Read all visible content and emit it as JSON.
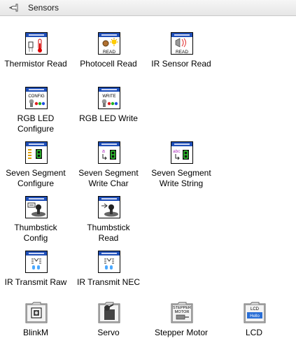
{
  "window": {
    "title": "Sensors"
  },
  "palette": [
    {
      "id": "thermistor-read",
      "label": "Thermistor Read",
      "icon": "thermistor-read-icon"
    },
    {
      "id": "photocell-read",
      "label": "Photocell Read",
      "icon": "photocell-read-icon",
      "icon_text": "READ"
    },
    {
      "id": "ir-sensor-read",
      "label": "IR Sensor Read",
      "icon": "ir-sensor-read-icon",
      "icon_text": "READ"
    },
    {
      "id": "rgb-led-configure",
      "label": "RGB LED\nConfigure",
      "icon": "rgb-led-configure-icon",
      "icon_text": "CONFIG"
    },
    {
      "id": "rgb-led-write",
      "label": "RGB LED Write",
      "icon": "rgb-led-write-icon",
      "icon_text": "WRITE"
    },
    {
      "id": "seven-segment-configure",
      "label": "Seven Segment\nConfigure",
      "icon": "seven-segment-configure-icon",
      "icon_text": "8"
    },
    {
      "id": "seven-segment-write-char",
      "label": "Seven Segment\nWrite Char",
      "icon": "seven-segment-write-char-icon",
      "icon_text": "8"
    },
    {
      "id": "seven-segment-write-string",
      "label": "Seven Segment\nWrite String",
      "icon": "seven-segment-write-string-icon",
      "icon_text": "8"
    },
    {
      "id": "thumbstick-config",
      "label": "Thumbstick\nConfig",
      "icon": "thumbstick-config-icon"
    },
    {
      "id": "thumbstick-read",
      "label": "Thumbstick\nRead",
      "icon": "thumbstick-read-icon"
    },
    {
      "id": "ir-transmit-raw",
      "label": "IR Transmit Raw",
      "icon": "ir-transmit-raw-icon"
    },
    {
      "id": "ir-transmit-nec",
      "label": "IR Transmit NEC",
      "icon": "ir-transmit-nec-icon"
    },
    {
      "id": "blinkm",
      "label": "BlinkM",
      "icon": "blinkm-folder-icon"
    },
    {
      "id": "servo",
      "label": "Servo",
      "icon": "servo-folder-icon"
    },
    {
      "id": "stepper-motor",
      "label": "Stepper Motor",
      "icon": "stepper-motor-folder-icon",
      "icon_text": "STEPPER\nMOTOR"
    },
    {
      "id": "lcd",
      "label": "LCD",
      "icon": "lcd-folder-icon",
      "icon_text": "LCD",
      "icon_subtext": "Hello"
    }
  ],
  "colors": {
    "arduino_banner": "#1f4fb8",
    "title_bar": "#eeeeee",
    "segment_green": "#2fd22f"
  }
}
